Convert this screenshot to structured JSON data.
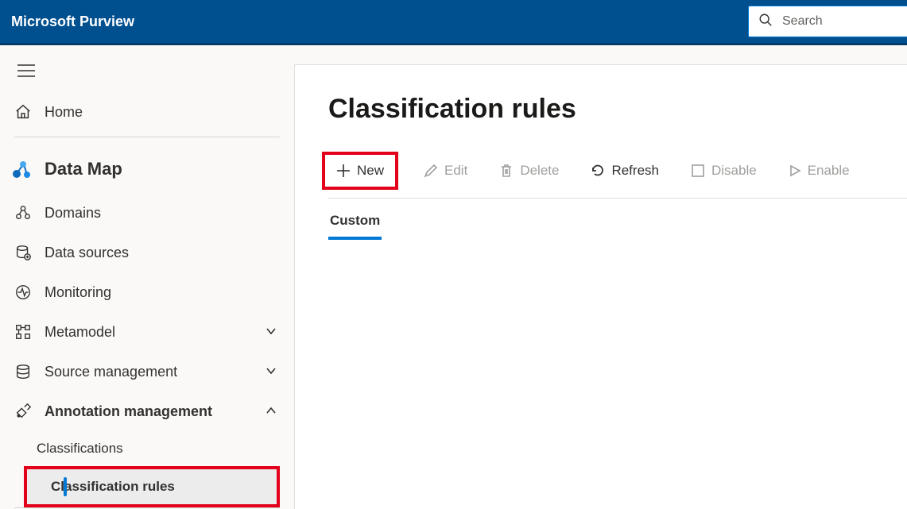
{
  "header": {
    "brand": "Microsoft Purview",
    "search_placeholder": "Search"
  },
  "sidebar": {
    "home": "Home",
    "section": "Data Map",
    "items": [
      {
        "label": "Domains",
        "expandable": false
      },
      {
        "label": "Data sources",
        "expandable": false
      },
      {
        "label": "Monitoring",
        "expandable": false
      },
      {
        "label": "Metamodel",
        "expandable": true
      },
      {
        "label": "Source management",
        "expandable": true
      },
      {
        "label": "Annotation management",
        "expandable": true,
        "expanded": true
      }
    ],
    "annotation_children": [
      {
        "label": "Classifications",
        "active": false
      },
      {
        "label": "Classification rules",
        "active": true
      }
    ]
  },
  "main": {
    "title": "Classification rules",
    "toolbar": {
      "new": "New",
      "edit": "Edit",
      "delete": "Delete",
      "refresh": "Refresh",
      "disable": "Disable",
      "enable": "Enable"
    },
    "tabs": {
      "custom": "Custom"
    }
  }
}
